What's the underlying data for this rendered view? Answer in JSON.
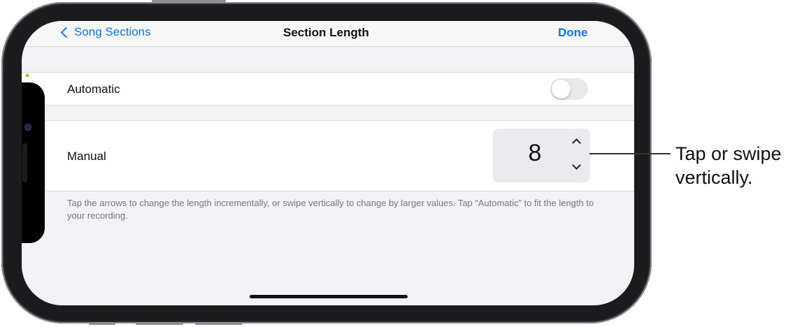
{
  "navbar": {
    "back_label": "Song Sections",
    "title": "Section Length",
    "done_label": "Done"
  },
  "automatic": {
    "label": "Automatic",
    "toggle_on": false
  },
  "manual": {
    "label": "Manual",
    "value": "8"
  },
  "footer": {
    "text": "Tap the arrows to change the length incrementally, or swipe vertically to change by larger values. Tap “Automatic” to fit the length to your recording."
  },
  "callout": {
    "text_line1": "Tap or swipe",
    "text_line2": "vertically."
  },
  "colors": {
    "accent": "#0a7aff",
    "background": "#f2f2f7",
    "toggle_off": "#e9e9eb"
  },
  "icons": [
    "chevron-left-icon",
    "chevron-up-icon",
    "chevron-down-icon"
  ]
}
